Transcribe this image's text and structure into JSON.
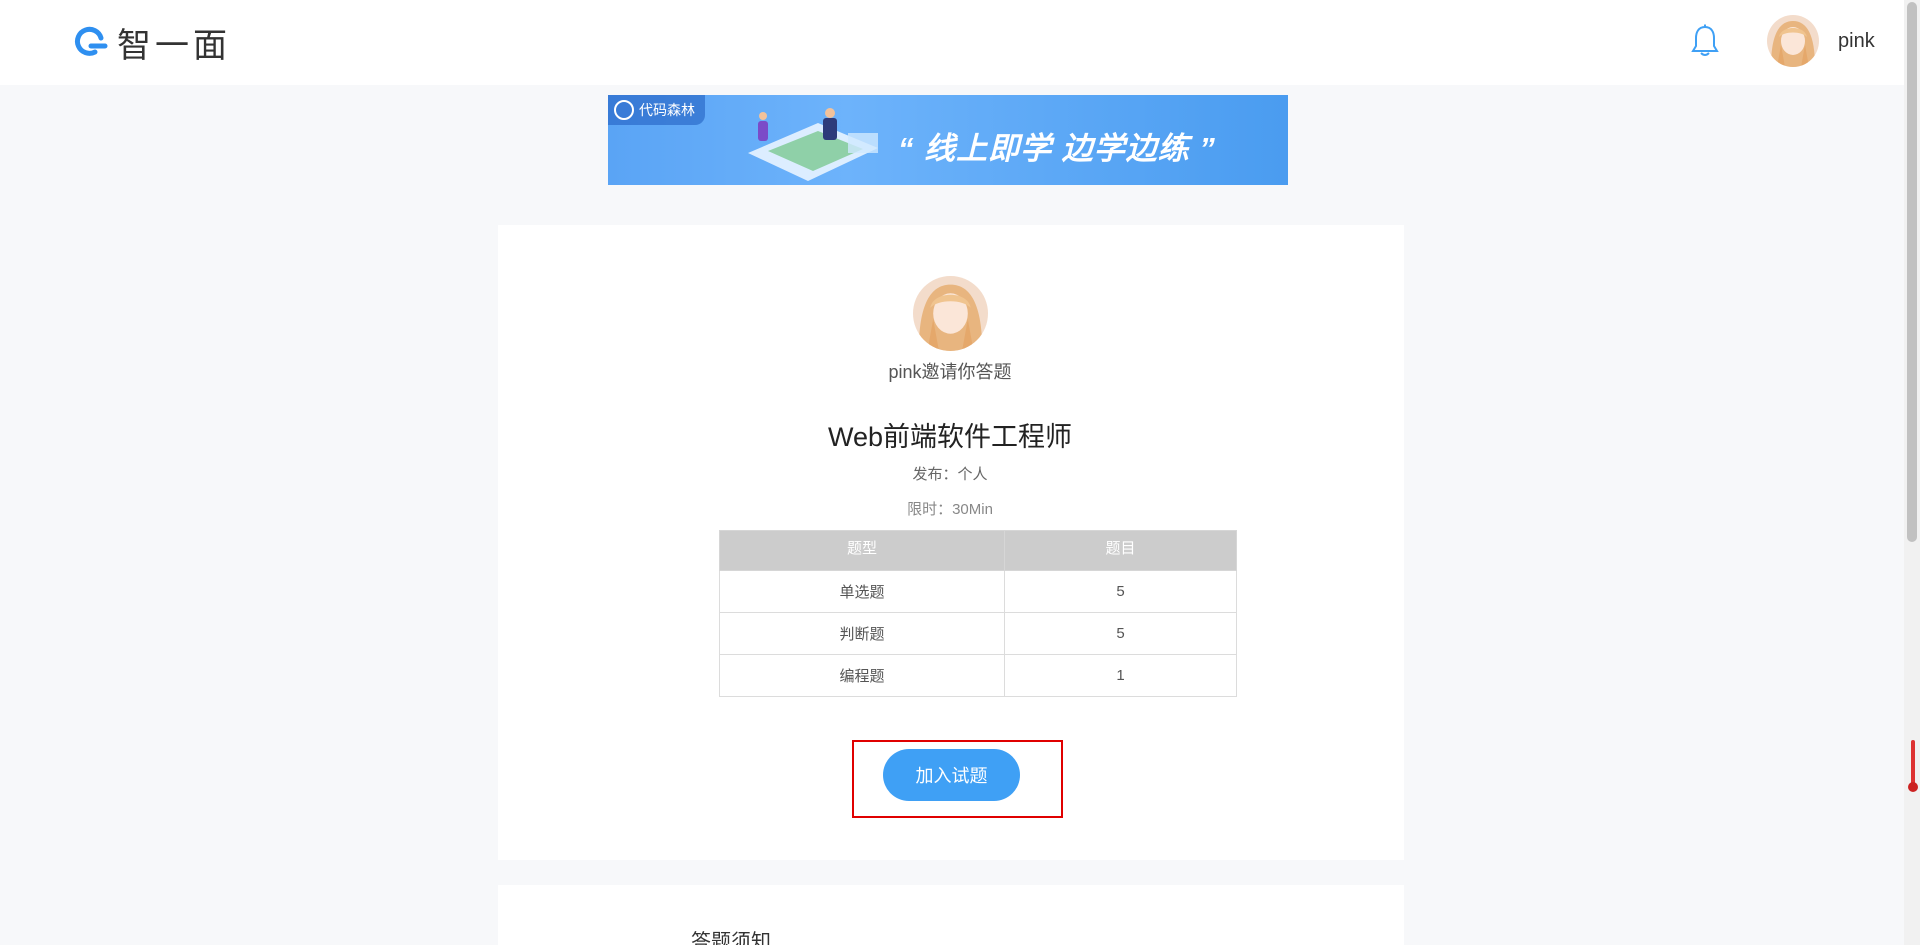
{
  "header": {
    "logo_text": "智一面",
    "username": "pink"
  },
  "banner": {
    "badge_text": "代码森林",
    "slogan": "“ 线上即学 边学边练 ”"
  },
  "invite": {
    "text": "pink邀请你答题"
  },
  "exam": {
    "title": "Web前端软件工程师",
    "publisher": "发布：个人",
    "time_limit": "限时：30Min"
  },
  "question_table": {
    "headers": [
      "题型",
      "题目"
    ],
    "rows": [
      {
        "type": "单选题",
        "count": "5"
      },
      {
        "type": "判断题",
        "count": "5"
      },
      {
        "type": "编程题",
        "count": "1"
      }
    ]
  },
  "actions": {
    "join_label": "加入试题"
  },
  "notice": {
    "title": "答题须知"
  },
  "colors": {
    "accent": "#3fa0f5",
    "highlight_border": "#e00000",
    "page_bg": "#f7f8fa",
    "table_header_bg": "#cccccc"
  }
}
